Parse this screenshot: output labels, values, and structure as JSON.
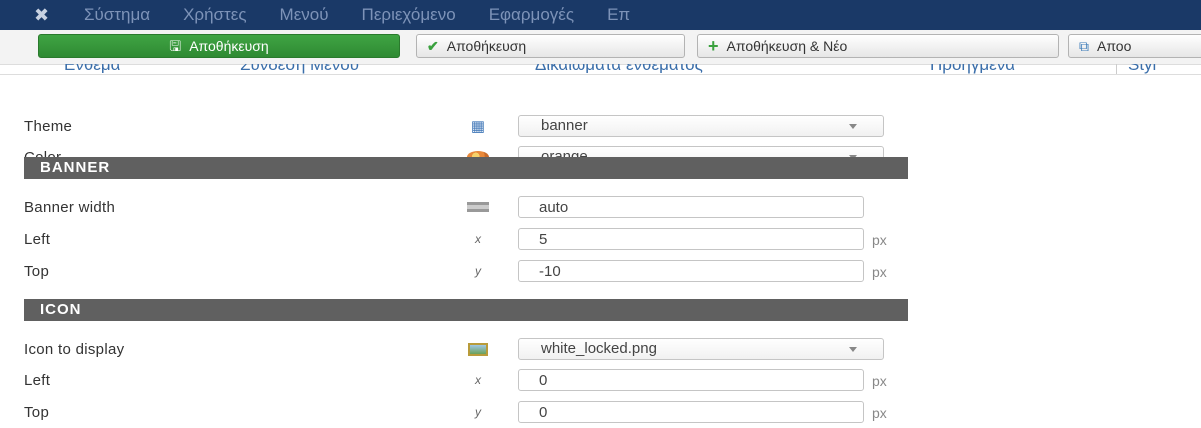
{
  "nav": {
    "items": [
      "Σύστημα",
      "Χρήστες",
      "Μενού",
      "Περιεχόμενο",
      "Εφαρμογές",
      "Επ"
    ]
  },
  "toolbar": {
    "save_label": "Αποθήκευση",
    "save_close_label": "Αποθήκευση",
    "save_new_label": "Αποθήκευση & Νέο",
    "save_copy_label": "Αποο"
  },
  "tabs": [
    "Ένθεμα",
    "Σύνδεση Μενού",
    "Δικαιώματα ενθέματος",
    "Προηγμένα",
    "Styl"
  ],
  "form": {
    "theme": {
      "label": "Theme",
      "value": "banner"
    },
    "color": {
      "label": "Color",
      "value": "orange"
    },
    "banner_section": "BANNER",
    "banner_width": {
      "label": "Banner width",
      "value": "auto"
    },
    "banner_left": {
      "label": "Left",
      "value": "5",
      "unit": "px"
    },
    "banner_top": {
      "label": "Top",
      "value": "-10",
      "unit": "px"
    },
    "icon_section": "ICON",
    "icon_display": {
      "label": "Icon to display",
      "value": "white_locked.png"
    },
    "icon_left": {
      "label": "Left",
      "value": "0",
      "unit": "px"
    },
    "icon_top": {
      "label": "Top",
      "value": "0",
      "unit": "px"
    }
  },
  "icons": {
    "x_glyph": "x",
    "y_glyph": "y"
  },
  "colors": {
    "navbar": "#1a3967",
    "primary_button": "#2f8a33",
    "section_header": "#606060"
  }
}
